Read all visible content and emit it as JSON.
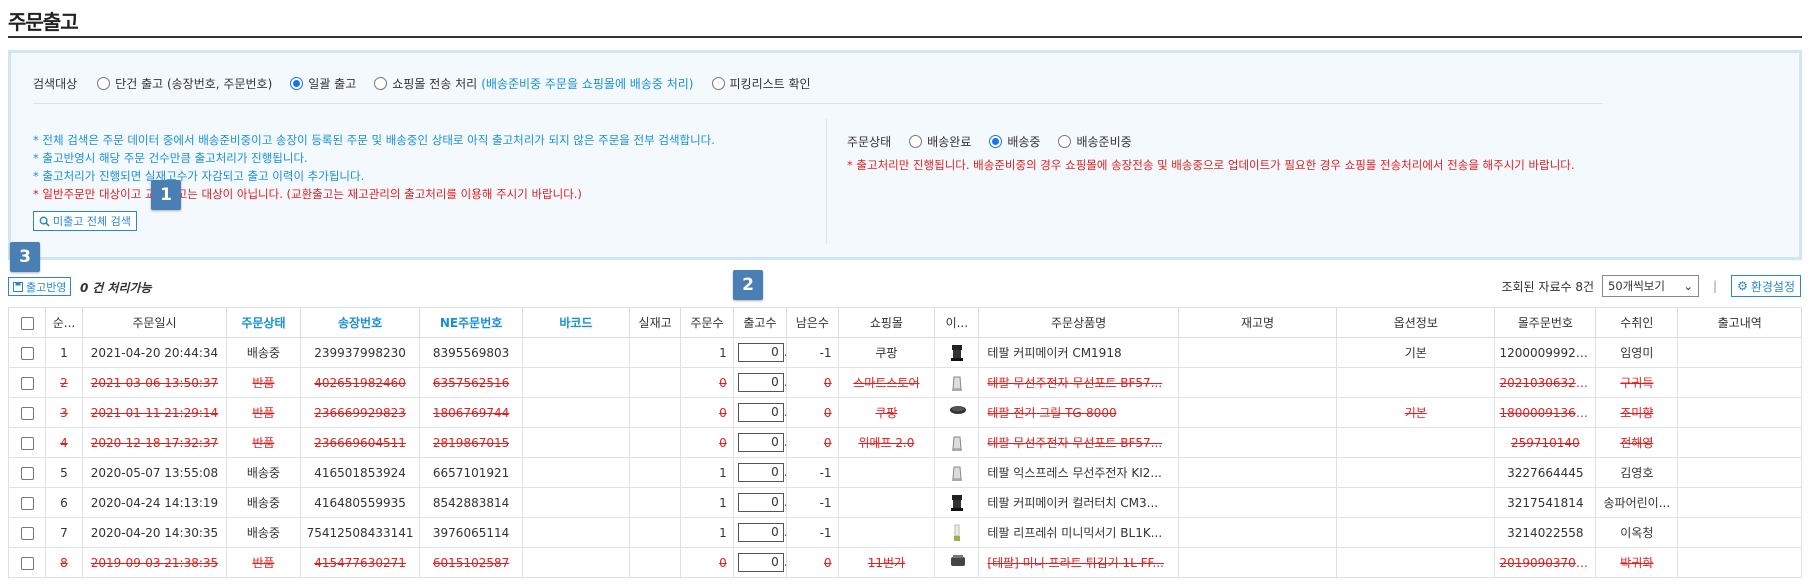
{
  "page": {
    "title": "주문출고"
  },
  "search": {
    "target_label": "검색대상",
    "targets": [
      {
        "label": "단건 출고 (송장번호, 주문번호)",
        "selected": false
      },
      {
        "label": "일괄 출고",
        "selected": true
      },
      {
        "label": "쇼핑몰 전송 처리",
        "selected": false
      },
      {
        "label": "피킹리스트 확인",
        "selected": false
      }
    ],
    "mall_note": "(배송준비중 주문을 쇼핑몰에 배송중 처리)",
    "notes": [
      "* 전체 검색은 주문 데이터 중에서 배송준비중이고 송장이 등록된 주문 및 배송중인 상태로 아직 출고처리가 되지 않은 주문을 전부 검색합니다.",
      "* 출고반영시 해당 주문 건수만큼 출고처리가 진행됩니다.",
      "* 출고처리가 진행되면 실재고수가 자감되고 출고 이력이 추가됩니다.",
      "* 일반주문만 대상이고 교환출고는 대상이 아닙니다. (교환출고는 재고관리의 출고처리를 이용해 주시기 바랍니다.)"
    ],
    "unshipped_button": "미출고 전체 검색",
    "status_label": "주문상태",
    "statuses": [
      {
        "label": "배송완료",
        "selected": false
      },
      {
        "label": "배송중",
        "selected": true
      },
      {
        "label": "배송준비중",
        "selected": false
      }
    ],
    "status_note": "* 출고처리만 진행됩니다. 배송준비중의 경우 쇼핑몰에 송장전송 및 배송중으로 업데이트가 필요한 경우 쇼핑몰 전송처리에서 전송을 해주시기 바랍니다."
  },
  "badges": {
    "b1": "1",
    "b2": "2",
    "b3": "3"
  },
  "toolbar": {
    "apply_button": "출고반영",
    "processable_count": "0",
    "processable_label": "건 처리가능",
    "result_count_text": "조회된 자료수 8건",
    "page_size": "50개씩보기",
    "settings_button": "환경설정"
  },
  "table": {
    "headers": [
      "순...",
      "주문일시",
      "주문상태",
      "송장번호",
      "NE주문번호",
      "바코드",
      "실재고",
      "주문수",
      "출고수",
      "남은수",
      "쇼핑몰",
      "이...",
      "주문상품명",
      "재고명",
      "옵션정보",
      "몰주문번호",
      "수취인",
      "출고내역"
    ],
    "rows": [
      {
        "no": "1",
        "date": "2021-04-20 20:44:34",
        "status": "배송중",
        "invoice": "239937998230",
        "ne": "8395569803",
        "barcode": "",
        "stock": "",
        "ordered": "1",
        "shipped": "0",
        "remain": "-1",
        "mall": "쿠팡",
        "icon": "coffee-maker-icon",
        "product": "테팔 커피메이커 CM1918",
        "stock_name": "",
        "option": "기본",
        "mall_order": "120000999290...",
        "receiver": "임영미",
        "history": "",
        "canceled": false
      },
      {
        "no": "2",
        "date": "2021-03-06 13:50:37",
        "status": "반품",
        "invoice": "402651982460",
        "ne": "6357562516",
        "barcode": "",
        "stock": "",
        "ordered": "0",
        "shipped": "0",
        "remain": "0",
        "mall": "스마트스토어",
        "icon": "kettle-icon",
        "product": "테팔 무선주전자 무선포트 BF57...",
        "stock_name": "",
        "option": "",
        "mall_order": "202103063204...",
        "receiver": "구귀득",
        "history": "",
        "canceled": true
      },
      {
        "no": "3",
        "date": "2021-01-11 21:29:14",
        "status": "반품",
        "invoice": "236669929823",
        "ne": "1806769744",
        "barcode": "",
        "stock": "",
        "ordered": "0",
        "shipped": "0",
        "remain": "0",
        "mall": "쿠팡",
        "icon": "grill-icon",
        "product": "테팔 전기 그릴 TG-8000",
        "stock_name": "",
        "option": "기본",
        "mall_order": "180000913684...",
        "receiver": "조미향",
        "history": "",
        "canceled": true
      },
      {
        "no": "4",
        "date": "2020-12-18 17:32:37",
        "status": "반품",
        "invoice": "236669604511",
        "ne": "2819867015",
        "barcode": "",
        "stock": "",
        "ordered": "0",
        "shipped": "0",
        "remain": "0",
        "mall": "위메프 2.0",
        "icon": "kettle-icon",
        "product": "테팔 무선주전자 무선포트 BF57...",
        "stock_name": "",
        "option": "",
        "mall_order": "259710140",
        "receiver": "전해영",
        "history": "",
        "canceled": true
      },
      {
        "no": "5",
        "date": "2020-05-07 13:55:08",
        "status": "배송중",
        "invoice": "416501853924",
        "ne": "6657101921",
        "barcode": "",
        "stock": "",
        "ordered": "1",
        "shipped": "0",
        "remain": "-1",
        "mall": "",
        "icon": "kettle-icon",
        "product": "테팔 익스프레스 무선주전자 KI2...",
        "stock_name": "",
        "option": "",
        "mall_order": "3227664445",
        "receiver": "김영호",
        "history": "",
        "canceled": false
      },
      {
        "no": "6",
        "date": "2020-04-24 14:13:19",
        "status": "배송중",
        "invoice": "416480559935",
        "ne": "8542883814",
        "barcode": "",
        "stock": "",
        "ordered": "1",
        "shipped": "0",
        "remain": "-1",
        "mall": "",
        "icon": "coffee-maker-icon",
        "product": "테팔 커피메이커 컬러터치 CM3...",
        "stock_name": "",
        "option": "",
        "mall_order": "3217541814",
        "receiver": "송파어린이...",
        "history": "",
        "canceled": false
      },
      {
        "no": "7",
        "date": "2020-04-20 14:30:35",
        "status": "배송중",
        "invoice": "75412508433141",
        "ne": "3976065114",
        "barcode": "",
        "stock": "",
        "ordered": "1",
        "shipped": "0",
        "remain": "-1",
        "mall": "",
        "icon": "blender-icon",
        "product": "테팔 리프레쉬 미니믹서기 BL1K...",
        "stock_name": "",
        "option": "",
        "mall_order": "3214022558",
        "receiver": "이옥청",
        "history": "",
        "canceled": false
      },
      {
        "no": "8",
        "date": "2019-09-03 21:38:35",
        "status": "반품",
        "invoice": "415477630271",
        "ne": "6015102587",
        "barcode": "",
        "stock": "",
        "ordered": "0",
        "shipped": "0",
        "remain": "0",
        "mall": "11번가",
        "icon": "fryer-icon",
        "product": "[테팔] 미니 프라트 튀김기 1L FF...",
        "stock_name": "",
        "option": "",
        "mall_order": "201909037012...",
        "receiver": "박귀화",
        "history": "",
        "canceled": true
      }
    ]
  },
  "colors": {
    "accent": "#1a8fd8",
    "warning": "#e02020",
    "badge": "#4a7fb3"
  }
}
